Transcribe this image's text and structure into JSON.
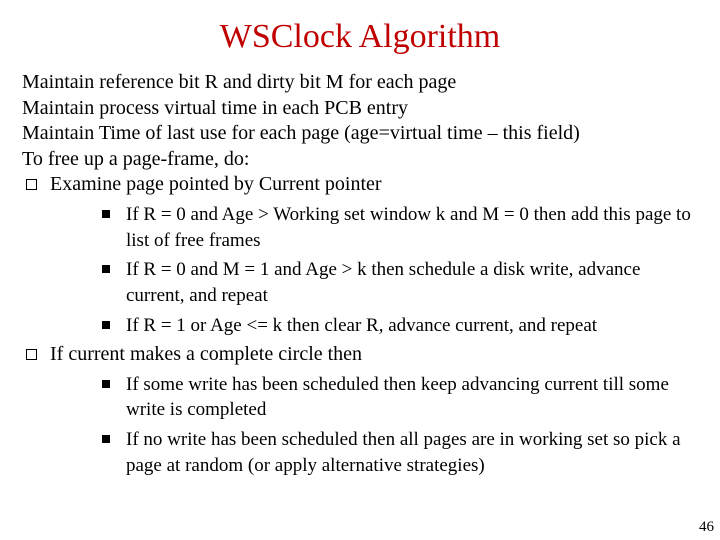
{
  "title": "WSClock Algorithm",
  "intro": [
    "Maintain reference bit R and dirty bit M for each page",
    "Maintain process virtual time in each PCB entry",
    "Maintain Time of last use for each page (age=virtual time – this field)",
    "To free up a page-frame, do:"
  ],
  "top": [
    {
      "text": "Examine page pointed by Current pointer",
      "sub": [
        "If R = 0 and Age > Working set window k and M = 0 then add this page to list of free frames",
        "If R = 0 and M = 1 and Age > k then schedule a disk write, advance current, and repeat",
        "If R = 1 or Age <= k then clear R, advance current, and repeat"
      ]
    },
    {
      "text": "If current makes a complete circle then",
      "sub": [
        "If some write has been scheduled then keep advancing current till some write is completed",
        "If no write has been scheduled then all pages are in working set so pick a page at random (or apply alternative strategies)"
      ]
    }
  ],
  "page_number": "46"
}
